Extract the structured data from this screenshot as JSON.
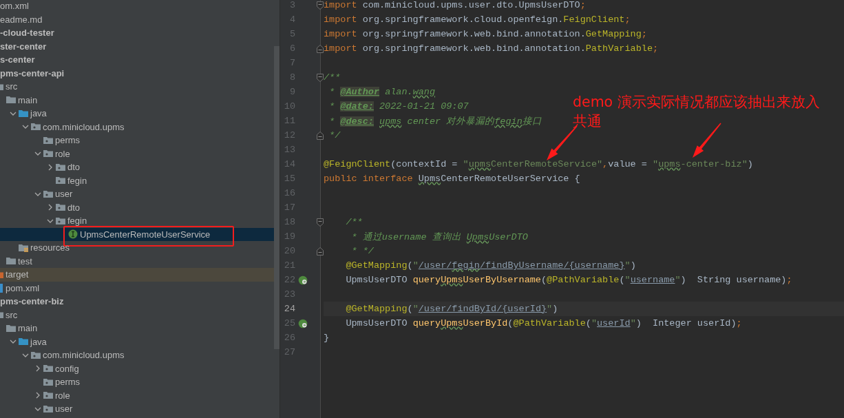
{
  "project_tree": {
    "items": [
      {
        "name": "om.xml",
        "kind": "file",
        "selected": false
      },
      {
        "name": "eadme.md",
        "kind": "file",
        "selected": false
      },
      {
        "name": "-cloud-tester",
        "kind": "module",
        "selected": false
      },
      {
        "name": "ster-center",
        "kind": "module",
        "selected": false
      },
      {
        "name": "s-center",
        "kind": "module",
        "selected": false
      },
      {
        "name": "pms-center-api",
        "kind": "module",
        "selected": false,
        "children": [
          {
            "name": "src",
            "kind": "folder",
            "selected": false,
            "children": [
              {
                "name": "main",
                "kind": "folder",
                "selected": false,
                "children": [
                  {
                    "name": "java",
                    "kind": "source-root",
                    "selected": false,
                    "expanded": true,
                    "children": [
                      {
                        "name": "com.minicloud.upms",
                        "kind": "package",
                        "selected": false,
                        "expanded": true,
                        "children": [
                          {
                            "name": "perms",
                            "kind": "package",
                            "selected": false
                          },
                          {
                            "name": "role",
                            "kind": "package",
                            "selected": false,
                            "expanded": true,
                            "children": [
                              {
                                "name": "dto",
                                "kind": "package",
                                "selected": false,
                                "expanded": false
                              },
                              {
                                "name": "fegin",
                                "kind": "package",
                                "selected": false
                              }
                            ]
                          },
                          {
                            "name": "user",
                            "kind": "package",
                            "selected": false,
                            "expanded": true,
                            "children": [
                              {
                                "name": "dto",
                                "kind": "package",
                                "selected": false,
                                "expanded": false
                              },
                              {
                                "name": "fegin",
                                "kind": "package",
                                "selected": false,
                                "expanded": true,
                                "children": [
                                  {
                                    "name": "UpmsCenterRemoteUserService",
                                    "kind": "interface",
                                    "selected": true,
                                    "highlighted": true
                                  }
                                ]
                              }
                            ]
                          }
                        ]
                      }
                    ]
                  },
                  {
                    "name": "resources",
                    "kind": "resources-root",
                    "selected": false
                  }
                ]
              },
              {
                "name": "test",
                "kind": "folder",
                "selected": false
              }
            ]
          },
          {
            "name": "target",
            "kind": "excluded",
            "selected": false
          },
          {
            "name": "pom.xml",
            "kind": "xml-file",
            "selected": false
          }
        ]
      },
      {
        "name": "pms-center-biz",
        "kind": "module",
        "selected": false,
        "children": [
          {
            "name": "src",
            "kind": "folder",
            "selected": false,
            "children": [
              {
                "name": "main",
                "kind": "folder",
                "selected": false,
                "children": [
                  {
                    "name": "java",
                    "kind": "source-root",
                    "selected": false,
                    "expanded": true,
                    "children": [
                      {
                        "name": "com.minicloud.upms",
                        "kind": "package",
                        "selected": false,
                        "expanded": true,
                        "children": [
                          {
                            "name": "config",
                            "kind": "package",
                            "selected": false,
                            "expanded": false
                          },
                          {
                            "name": "perms",
                            "kind": "package",
                            "selected": false
                          },
                          {
                            "name": "role",
                            "kind": "package",
                            "selected": false,
                            "expanded": false
                          },
                          {
                            "name": "user",
                            "kind": "package",
                            "selected": false,
                            "expanded": true
                          }
                        ]
                      }
                    ]
                  }
                ]
              }
            ]
          }
        ]
      }
    ]
  },
  "editor": {
    "lines": [
      {
        "number": "3",
        "current": false,
        "fold_start": true,
        "tokens": [
          {
            "text": "import",
            "kind": "keyword"
          },
          {
            "text": " com.minicloud.upms.user.dto.UpmsUserDTO",
            "kind": "plain"
          },
          {
            "text": ";",
            "kind": "punct"
          }
        ]
      },
      {
        "number": "4",
        "current": false,
        "tokens": [
          {
            "text": "import",
            "kind": "keyword"
          },
          {
            "text": " org.springframework.cloud.openfeign.",
            "kind": "plain"
          },
          {
            "text": "FeignClient",
            "kind": "annotation"
          },
          {
            "text": ";",
            "kind": "punct"
          }
        ]
      },
      {
        "number": "5",
        "current": false,
        "tokens": [
          {
            "text": "import",
            "kind": "keyword"
          },
          {
            "text": " org.springframework.web.bind.annotation.",
            "kind": "plain"
          },
          {
            "text": "GetMapping",
            "kind": "annotation"
          },
          {
            "text": ";",
            "kind": "punct"
          }
        ]
      },
      {
        "number": "6",
        "current": false,
        "fold_end": true,
        "tokens": [
          {
            "text": "import",
            "kind": "keyword"
          },
          {
            "text": " org.springframework.web.bind.annotation.",
            "kind": "plain"
          },
          {
            "text": "PathVariable",
            "kind": "annotation"
          },
          {
            "text": ";",
            "kind": "punct"
          }
        ]
      },
      {
        "number": "7",
        "current": false
      },
      {
        "number": "8",
        "current": false,
        "fold_start": true,
        "tokens": [
          {
            "text": "/**",
            "kind": "doc"
          }
        ]
      },
      {
        "number": "9",
        "current": false,
        "tokens": [
          {
            "text": " * ",
            "kind": "doc"
          },
          {
            "text": "@Author",
            "kind": "doctag"
          },
          {
            "text": " alan.",
            "kind": "doc"
          },
          {
            "text": "wang",
            "kind": "doc",
            "typo": true
          }
        ]
      },
      {
        "number": "10",
        "current": false,
        "tokens": [
          {
            "text": " * ",
            "kind": "doc"
          },
          {
            "text": "@date:",
            "kind": "doctag"
          },
          {
            "text": " 2022-01-21 09:07",
            "kind": "doc"
          }
        ]
      },
      {
        "number": "11",
        "current": false,
        "tokens": [
          {
            "text": " * ",
            "kind": "doc"
          },
          {
            "text": "@desc:",
            "kind": "doctag"
          },
          {
            "text": " upms",
            "kind": "doc",
            "typo": true
          },
          {
            "text": " center 对外暴漏的",
            "kind": "doc"
          },
          {
            "text": "fegin",
            "kind": "doc",
            "typo": true
          },
          {
            "text": "接口",
            "kind": "doc"
          }
        ]
      },
      {
        "number": "12",
        "current": false,
        "fold_end": true,
        "tokens": [
          {
            "text": " */",
            "kind": "doc"
          }
        ]
      },
      {
        "number": "13",
        "current": false
      },
      {
        "number": "14",
        "current": false,
        "tokens": [
          {
            "text": "@FeignClient",
            "kind": "annotation"
          },
          {
            "text": "(contextId = ",
            "kind": "plain"
          },
          {
            "text": "\"",
            "kind": "string"
          },
          {
            "text": "upms",
            "kind": "string",
            "typo": true
          },
          {
            "text": "CenterRemoteService\"",
            "kind": "string"
          },
          {
            "text": ",",
            "kind": "punct"
          },
          {
            "text": "value = ",
            "kind": "plain"
          },
          {
            "text": "\"",
            "kind": "string"
          },
          {
            "text": "upms",
            "kind": "string",
            "typo": true
          },
          {
            "text": "-center-biz\"",
            "kind": "string"
          },
          {
            "text": ")",
            "kind": "plain"
          }
        ]
      },
      {
        "number": "15",
        "current": false,
        "tokens": [
          {
            "text": "public interface ",
            "kind": "keyword"
          },
          {
            "text": "Upms",
            "kind": "plain",
            "typo": true
          },
          {
            "text": "CenterRemoteUserService {",
            "kind": "plain"
          }
        ]
      },
      {
        "number": "16",
        "current": false
      },
      {
        "number": "17",
        "current": false
      },
      {
        "number": "18",
        "current": false,
        "fold_start": true,
        "tokens": [
          {
            "text": "    /**",
            "kind": "doc"
          }
        ]
      },
      {
        "number": "19",
        "current": false,
        "tokens": [
          {
            "text": "     * 通过username 查询出 ",
            "kind": "doc"
          },
          {
            "text": "Upms",
            "kind": "doc",
            "typo": true
          },
          {
            "text": "UserDTO",
            "kind": "doc"
          }
        ]
      },
      {
        "number": "20",
        "current": false,
        "fold_end": true,
        "tokens": [
          {
            "text": "     * */",
            "kind": "doc"
          }
        ]
      },
      {
        "number": "21",
        "current": false,
        "tokens": [
          {
            "text": "    @GetMapping",
            "kind": "annotation"
          },
          {
            "text": "(",
            "kind": "plain"
          },
          {
            "text": "\"",
            "kind": "string"
          },
          {
            "text": "/user/",
            "kind": "url"
          },
          {
            "text": "fegin",
            "kind": "url",
            "typo": true
          },
          {
            "text": "/findByUsername/{username}",
            "kind": "url"
          },
          {
            "text": "\"",
            "kind": "string"
          },
          {
            "text": ")",
            "kind": "plain"
          }
        ]
      },
      {
        "number": "22",
        "current": false,
        "implemented": true,
        "tokens": [
          {
            "text": "    UpmsUserDTO ",
            "kind": "plain"
          },
          {
            "text": "query",
            "kind": "method"
          },
          {
            "text": "Upms",
            "kind": "method",
            "typo": true
          },
          {
            "text": "UserByUsername",
            "kind": "method"
          },
          {
            "text": "(",
            "kind": "plain"
          },
          {
            "text": "@PathVariable",
            "kind": "annotation"
          },
          {
            "text": "(",
            "kind": "plain"
          },
          {
            "text": "\"",
            "kind": "string"
          },
          {
            "text": "username",
            "kind": "url"
          },
          {
            "text": "\"",
            "kind": "string"
          },
          {
            "text": ")  String username)",
            "kind": "plain"
          },
          {
            "text": ";",
            "kind": "punct"
          }
        ]
      },
      {
        "number": "23",
        "current": false
      },
      {
        "number": "24",
        "current": true,
        "tokens": [
          {
            "text": "    @GetMapping",
            "kind": "annotation"
          },
          {
            "text": "(",
            "kind": "plain"
          },
          {
            "text": "\"",
            "kind": "string"
          },
          {
            "text": "/user/findById/{userId}",
            "kind": "url"
          },
          {
            "text": "\"",
            "kind": "string"
          },
          {
            "text": ")",
            "kind": "plain"
          }
        ]
      },
      {
        "number": "25",
        "current": false,
        "implemented": true,
        "tokens": [
          {
            "text": "    UpmsUserDTO ",
            "kind": "plain"
          },
          {
            "text": "query",
            "kind": "method"
          },
          {
            "text": "Upms",
            "kind": "method",
            "typo": true
          },
          {
            "text": "UserById",
            "kind": "method"
          },
          {
            "text": "(",
            "kind": "plain"
          },
          {
            "text": "@PathVariable",
            "kind": "annotation"
          },
          {
            "text": "(",
            "kind": "plain"
          },
          {
            "text": "\"",
            "kind": "string"
          },
          {
            "text": "userId",
            "kind": "url"
          },
          {
            "text": "\"",
            "kind": "string"
          },
          {
            "text": ")  Integer userId)",
            "kind": "plain"
          },
          {
            "text": ";",
            "kind": "punct"
          }
        ]
      },
      {
        "number": "26",
        "current": false,
        "tokens": [
          {
            "text": "}",
            "kind": "plain"
          }
        ]
      },
      {
        "number": "27",
        "current": false
      }
    ]
  },
  "annotation": {
    "text": "demo 演示实际情况都应该抽出来放入共通"
  }
}
